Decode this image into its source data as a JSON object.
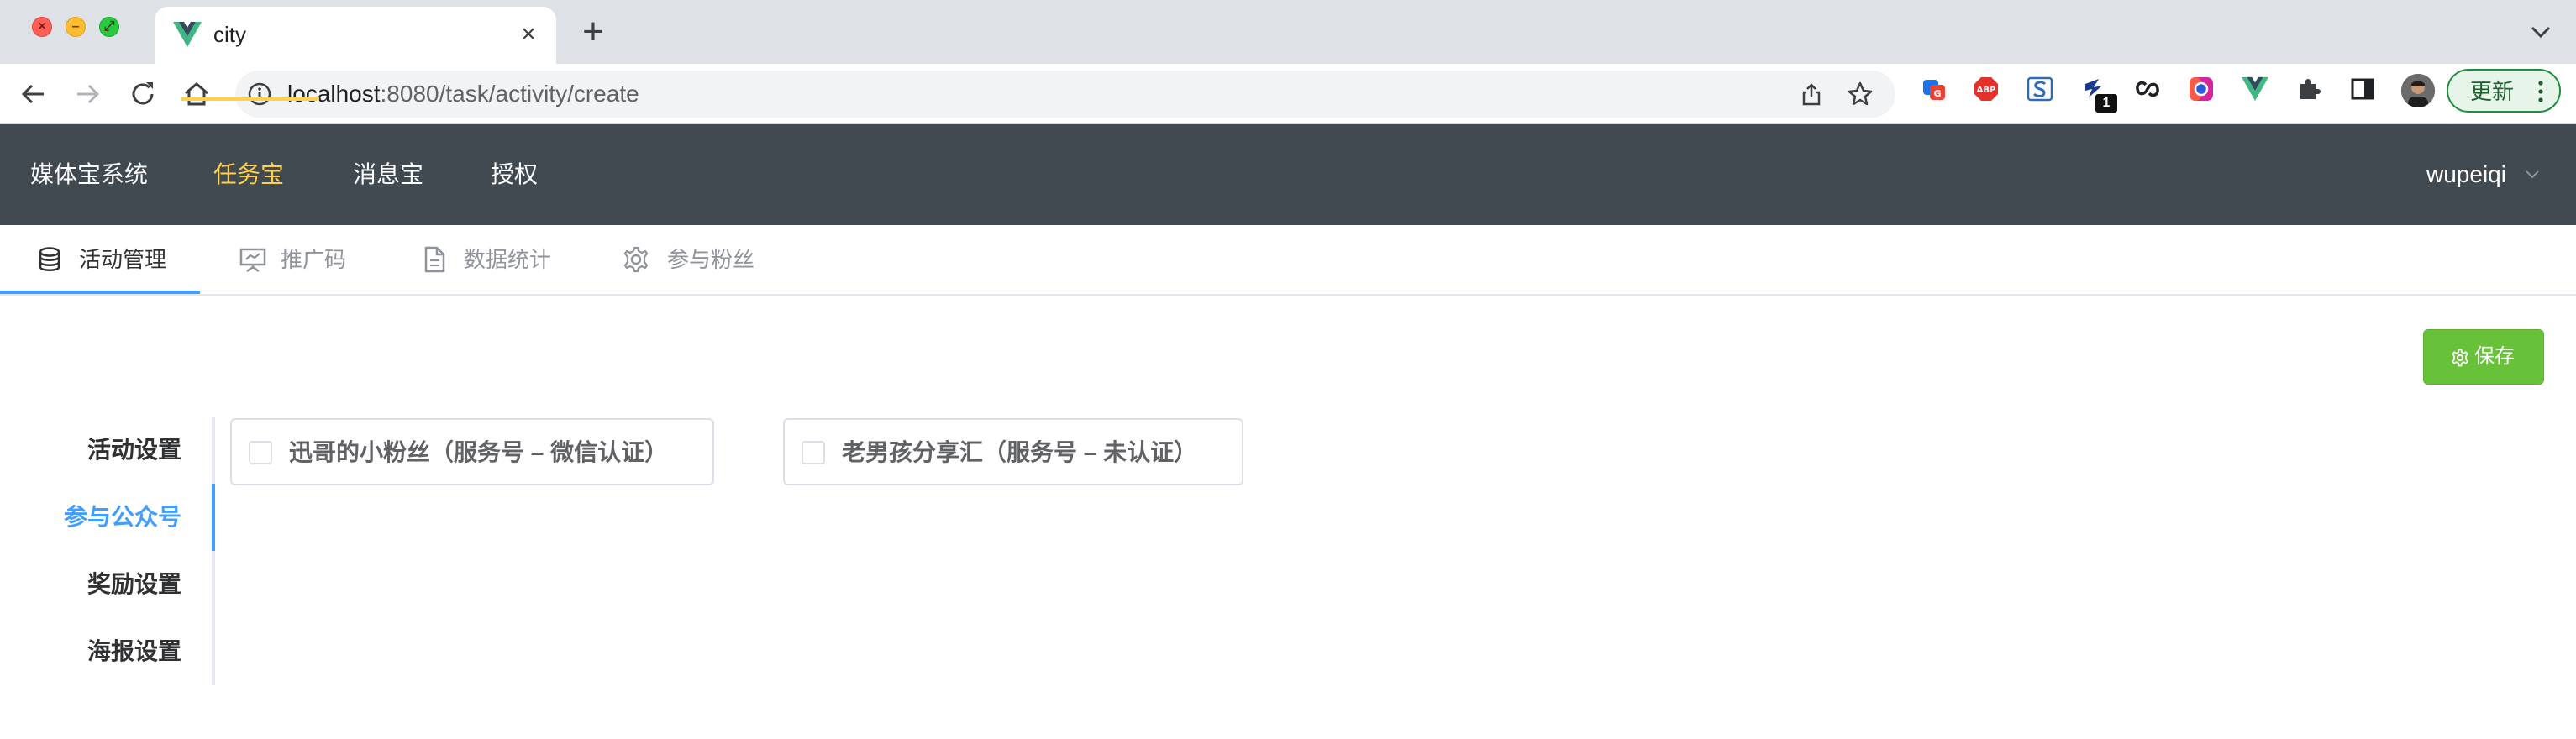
{
  "browser": {
    "tab_title": "city",
    "url_host": "localhost",
    "url_rest": ":8080/task/activity/create",
    "ext_badge": "1",
    "update_label": "更新"
  },
  "header": {
    "brand": "媒体宝系统",
    "nav": [
      "任务宝",
      "消息宝",
      "授权"
    ],
    "active_nav": "任务宝",
    "user": "wupeiqi"
  },
  "subtabs": [
    {
      "label": "活动管理",
      "icon": "database-icon",
      "active": true
    },
    {
      "label": "推广码",
      "icon": "presentation-icon",
      "active": false
    },
    {
      "label": "数据统计",
      "icon": "document-icon",
      "active": false
    },
    {
      "label": "参与粉丝",
      "icon": "gear-icon",
      "active": false
    }
  ],
  "toolbar": {
    "save_label": "保存"
  },
  "sidetabs": [
    {
      "label": "活动设置",
      "active": false
    },
    {
      "label": "参与公众号",
      "active": true
    },
    {
      "label": "奖励设置",
      "active": false
    },
    {
      "label": "海报设置",
      "active": false
    }
  ],
  "accounts": [
    {
      "label": "迅哥的小粉丝（服务号 – 微信认证）",
      "checked": false
    },
    {
      "label": "老男孩分享汇（服务号 – 未认证）",
      "checked": false
    }
  ],
  "colors": {
    "header_bg": "#424a51",
    "active_nav": "#ffd04b",
    "primary": "#409eff",
    "success": "#67c23a"
  }
}
